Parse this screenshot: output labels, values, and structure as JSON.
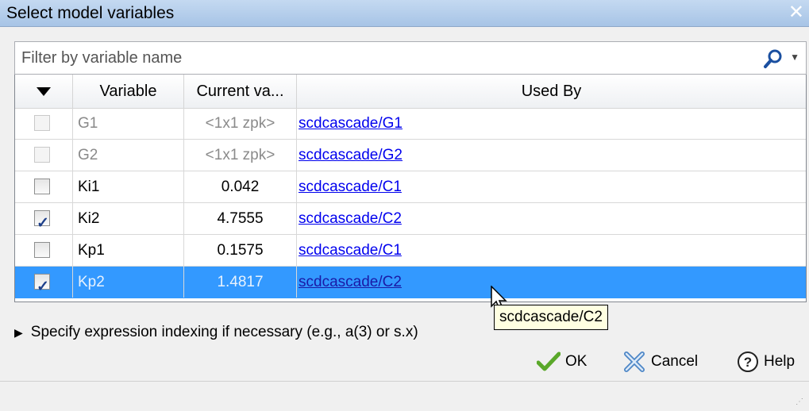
{
  "window": {
    "title": "Select model variables",
    "close_glyph": "✕"
  },
  "filter": {
    "placeholder": "Filter by variable name"
  },
  "table": {
    "headers": {
      "check": "",
      "variable": "Variable",
      "current_value": "Current va...",
      "used_by": "Used By"
    },
    "rows": [
      {
        "checked": false,
        "enabled": false,
        "variable": "G1",
        "value": "<1x1 zpk>",
        "used_by": "scdcascade/G1",
        "selected": false
      },
      {
        "checked": false,
        "enabled": false,
        "variable": "G2",
        "value": "<1x1 zpk>",
        "used_by": "scdcascade/G2",
        "selected": false
      },
      {
        "checked": false,
        "enabled": true,
        "variable": "Ki1",
        "value": "0.042",
        "used_by": "scdcascade/C1",
        "selected": false
      },
      {
        "checked": true,
        "enabled": true,
        "variable": "Ki2",
        "value": "4.7555",
        "used_by": "scdcascade/C2",
        "selected": false
      },
      {
        "checked": false,
        "enabled": true,
        "variable": "Kp1",
        "value": "0.1575",
        "used_by": "scdcascade/C1",
        "selected": false
      },
      {
        "checked": true,
        "enabled": true,
        "variable": "Kp2",
        "value": "1.4817",
        "used_by": "scdcascade/C2",
        "selected": true
      }
    ]
  },
  "expander": {
    "label": "Specify expression indexing if necessary (e.g., a(3) or s.x)"
  },
  "tooltip": {
    "text": "scdcascade/C2"
  },
  "buttons": {
    "ok": "OK",
    "cancel": "Cancel",
    "help": "Help"
  },
  "icons": {
    "search": "search-icon",
    "check": "checkmark-icon",
    "cancel": "cancel-x-icon",
    "help": "question-circle-icon"
  },
  "colors": {
    "selection": "#3399ff",
    "link": "#0000ee",
    "titlebar": "#b6cfee"
  }
}
